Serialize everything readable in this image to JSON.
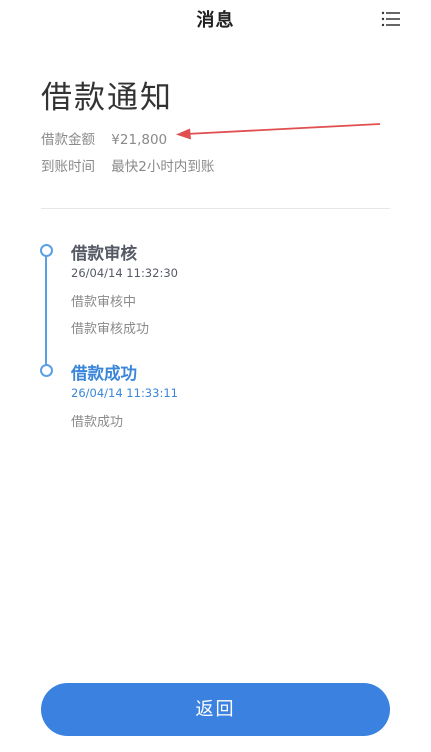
{
  "header": {
    "title": "消息",
    "menu_icon": "list-menu-icon"
  },
  "notice": {
    "title": "借款通知",
    "amount_label": "借款金额",
    "amount_value": "¥21,800",
    "arrival_label": "到账时间",
    "arrival_value": "最快2小时内到账"
  },
  "timeline": {
    "accent_color": "#5aa0e6",
    "steps": [
      {
        "title": "借款审核",
        "time": "26/04/14 11:32:30",
        "details": [
          "借款审核中",
          "借款审核成功"
        ]
      },
      {
        "title": "借款成功",
        "time": "26/04/14 11:33:11",
        "details": [
          "借款成功"
        ]
      }
    ]
  },
  "annotation": {
    "arrow_color": "#e05050"
  },
  "footer": {
    "back_label": "返回",
    "button_color": "#3b82e0"
  }
}
